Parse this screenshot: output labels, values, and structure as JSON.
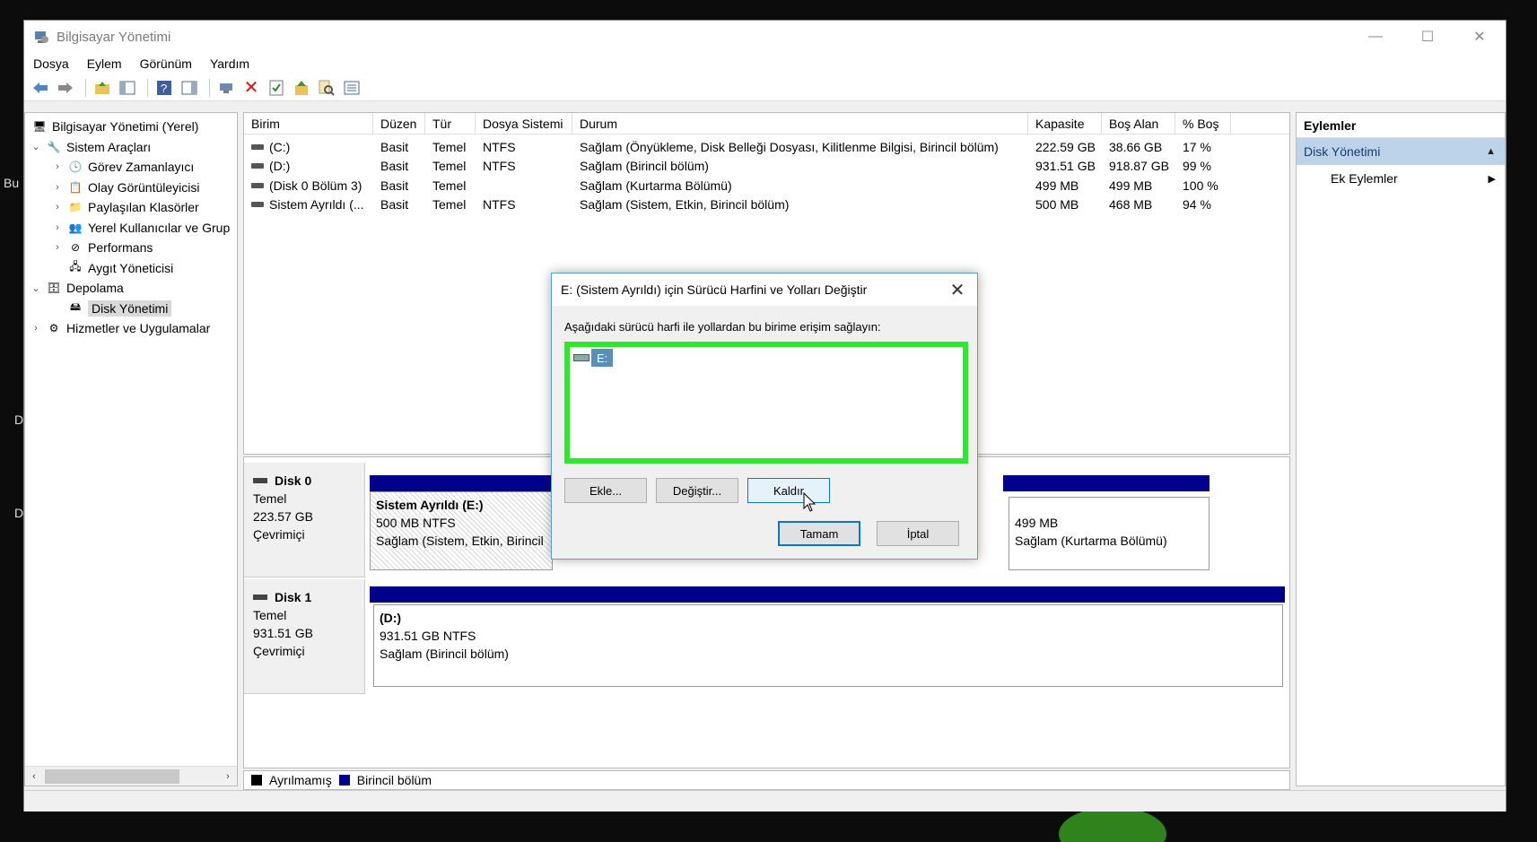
{
  "desktop": {
    "left_text_1": "Bu",
    "left_text_2": "D",
    "left_text_3": "D"
  },
  "window": {
    "title": "Bilgisayar Yönetimi",
    "controls": {
      "minimize": "—",
      "maximize": "☐",
      "close": "✕"
    }
  },
  "menu": [
    "Dosya",
    "Eylem",
    "Görünüm",
    "Yardım"
  ],
  "toolbar": {
    "icons": [
      "back-icon",
      "forward-icon",
      "up-folder-icon",
      "show-tree-icon",
      "help-icon",
      "properties-pane-icon",
      "connect-icon",
      "delete-icon",
      "check-icon",
      "export-icon",
      "search-icon",
      "list-icon"
    ]
  },
  "tree": {
    "items": [
      {
        "label": "Bilgisayar Yönetimi (Yerel)",
        "icon": "computer-icon",
        "indent": 0,
        "arrow": ""
      },
      {
        "label": "Sistem Araçları",
        "icon": "tools-icon",
        "indent": 1,
        "arrow": "⌄"
      },
      {
        "label": "Görev Zamanlayıcı",
        "icon": "clock-icon",
        "indent": 2,
        "arrow": "›"
      },
      {
        "label": "Olay Görüntüleyicisi",
        "icon": "event-viewer-icon",
        "indent": 2,
        "arrow": "›"
      },
      {
        "label": "Paylaşılan Klasörler",
        "icon": "shared-folder-icon",
        "indent": 2,
        "arrow": "›"
      },
      {
        "label": "Yerel Kullanıcılar ve Grup",
        "icon": "users-icon",
        "indent": 2,
        "arrow": "›"
      },
      {
        "label": "Performans",
        "icon": "performance-icon",
        "indent": 2,
        "arrow": "›"
      },
      {
        "label": "Aygıt Yöneticisi",
        "icon": "device-manager-icon",
        "indent": 2,
        "arrow": ""
      },
      {
        "label": "Depolama",
        "icon": "storage-icon",
        "indent": 1,
        "arrow": "⌄"
      },
      {
        "label": "Disk Yönetimi",
        "icon": "disk-icon",
        "indent": 2,
        "arrow": "",
        "selected": true
      },
      {
        "label": "Hizmetler ve Uygulamalar",
        "icon": "services-icon",
        "indent": 1,
        "arrow": "›"
      }
    ]
  },
  "volumes": {
    "columns": [
      "Birim",
      "Düzen",
      "Tür",
      "Dosya Sistemi",
      "Durum",
      "Kapasite",
      "Boş Alan",
      "% Boş"
    ],
    "rows": [
      [
        "(C:)",
        "Basit",
        "Temel",
        "NTFS",
        "Sağlam (Önyükleme, Disk Belleği Dosyası, Kilitlenme Bilgisi, Birincil bölüm)",
        "222.59 GB",
        "38.66 GB",
        "17 %"
      ],
      [
        "(D:)",
        "Basit",
        "Temel",
        "NTFS",
        "Sağlam (Birincil bölüm)",
        "931.51 GB",
        "918.87 GB",
        "99 %"
      ],
      [
        "(Disk 0 Bölüm 3)",
        "Basit",
        "Temel",
        "",
        "Sağlam (Kurtarma Bölümü)",
        "499 MB",
        "499 MB",
        "100 %"
      ],
      [
        "Sistem Ayrıldı (...",
        "Basit",
        "Temel",
        "NTFS",
        "Sağlam (Sistem, Etkin, Birincil bölüm)",
        "500 MB",
        "468 MB",
        "94 %"
      ]
    ]
  },
  "disks": [
    {
      "name": "Disk 0",
      "type": "Temel",
      "size": "223.57 GB",
      "status": "Çevrimiçi",
      "partitions": [
        {
          "name": "Sistem Ayrıldı  (E:)",
          "fs": "500 MB NTFS",
          "status": "Sağlam (Sistem, Etkin, Birincil"
        },
        {
          "name": "",
          "fs": "499 MB",
          "status": "Sağlam (Kurtarma Bölümü)"
        }
      ]
    },
    {
      "name": "Disk 1",
      "type": "Temel",
      "size": "931.51 GB",
      "status": "Çevrimiçi",
      "partitions": [
        {
          "name": "(D:)",
          "fs": "931.51 GB NTFS",
          "status": "Sağlam (Birincil bölüm)"
        }
      ]
    }
  ],
  "legend": {
    "unallocated": "Ayrılmamış",
    "primary": "Birincil bölüm",
    "unallocated_color": "#000000",
    "primary_color": "#00008b"
  },
  "actions": {
    "header": "Eylemler",
    "section": "Disk Yönetimi",
    "item": "Ek Eylemler"
  },
  "dialog": {
    "title": "E: (Sistem Ayrıldı) için Sürücü Harfini ve Yolları Değiştir",
    "prompt": "Aşağıdaki sürücü harfi ile yollardan bu birime erişim sağlayın:",
    "list_item": "E:",
    "highlight_color": "#2ee82e",
    "buttons": {
      "add": "Ekle...",
      "change": "Değiştir...",
      "remove": "Kaldır",
      "ok": "Tamam",
      "cancel": "İptal"
    }
  }
}
